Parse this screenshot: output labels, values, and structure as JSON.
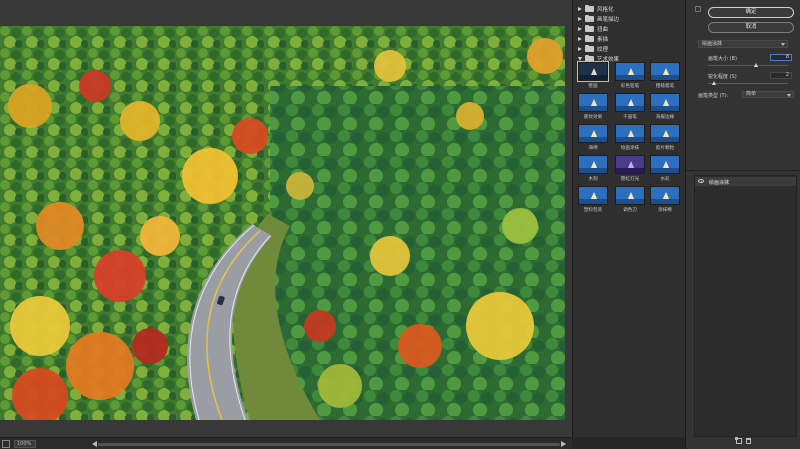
{
  "status": {
    "zoom": "100%"
  },
  "gallery": {
    "categories": [
      {
        "label": "风格化",
        "expanded": false
      },
      {
        "label": "画笔描边",
        "expanded": false
      },
      {
        "label": "扭曲",
        "expanded": false
      },
      {
        "label": "素描",
        "expanded": false
      },
      {
        "label": "纹理",
        "expanded": false
      },
      {
        "label": "艺术效果",
        "expanded": true
      }
    ],
    "filters": [
      {
        "label": "壁画",
        "selected": true
      },
      {
        "label": "彩色铅笔"
      },
      {
        "label": "粗糙蜡笔"
      },
      {
        "label": "底纹效果"
      },
      {
        "label": "干画笔"
      },
      {
        "label": "海报边缘"
      },
      {
        "label": "海绵"
      },
      {
        "label": "绘画涂抹"
      },
      {
        "label": "胶片颗粒"
      },
      {
        "label": "木刻"
      },
      {
        "label": "霓虹灯光"
      },
      {
        "label": "水彩"
      },
      {
        "label": "塑料包装"
      },
      {
        "label": "调色刀"
      },
      {
        "label": "涂抹棒"
      }
    ],
    "colors": {
      "thumb_sky": "#2d6fbf",
      "thumb_sea": "#1d4f8f"
    }
  },
  "settings": {
    "ok_label": "确定",
    "cancel_label": "取消",
    "current_filter": "绘画涂抹",
    "params": [
      {
        "label": "画笔大小 (B)",
        "value": "8",
        "fraction": 0.6
      },
      {
        "label": "锐化程度 (S)",
        "value": "2",
        "fraction": 0.05
      }
    ],
    "brush_type_label": "画笔类型 (T):",
    "brush_type_value": "简单",
    "layer_name": "绘画涂抹"
  }
}
